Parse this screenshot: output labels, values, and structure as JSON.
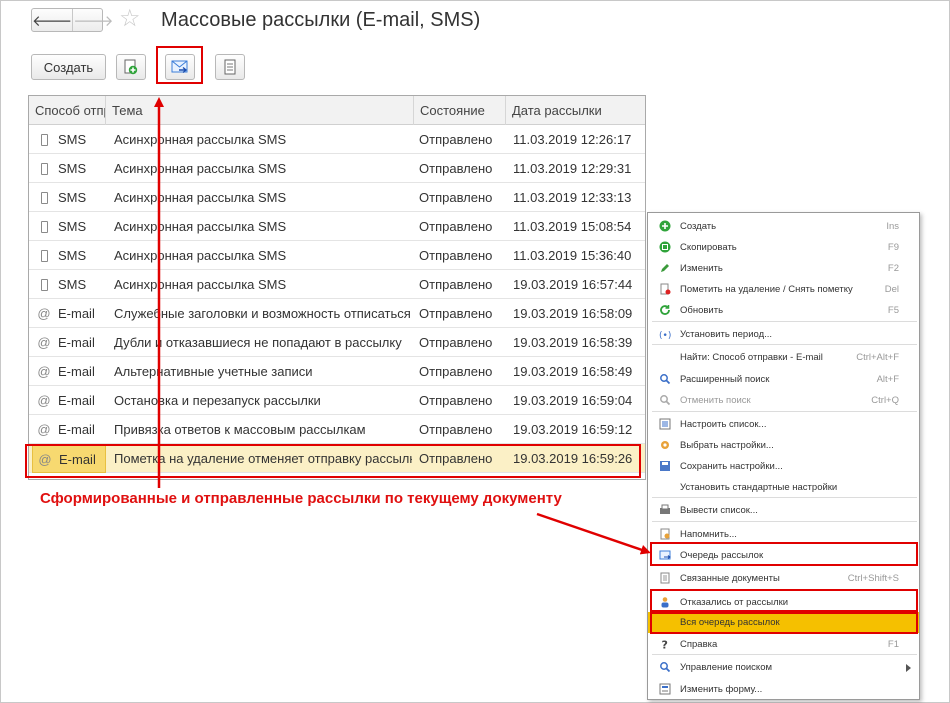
{
  "window": {
    "title": "Массовые рассылки (E-mail, SMS)"
  },
  "nav": {
    "back": "🡐",
    "forward": "🡒"
  },
  "toolbar": {
    "create_label": "Создать"
  },
  "table": {
    "columns": [
      "Способ отправки",
      "Тема",
      "Состояние",
      "Дата рассылки"
    ],
    "rows": [
      {
        "type": "phone",
        "method": "SMS",
        "subject": "Асинхронная рассылка SMS",
        "status": "Отправлено",
        "date": "11.03.2019 12:26:17"
      },
      {
        "type": "phone",
        "method": "SMS",
        "subject": "Асинхронная рассылка SMS",
        "status": "Отправлено",
        "date": "11.03.2019 12:29:31"
      },
      {
        "type": "phone",
        "method": "SMS",
        "subject": "Асинхронная рассылка SMS",
        "status": "Отправлено",
        "date": "11.03.2019 12:33:13"
      },
      {
        "type": "phone",
        "method": "SMS",
        "subject": "Асинхронная рассылка SMS",
        "status": "Отправлено",
        "date": "11.03.2019 15:08:54"
      },
      {
        "type": "phone",
        "method": "SMS",
        "subject": "Асинхронная рассылка SMS",
        "status": "Отправлено",
        "date": "11.03.2019 15:36:40"
      },
      {
        "type": "phone",
        "method": "SMS",
        "subject": "Асинхронная рассылка SMS",
        "status": "Отправлено",
        "date": "19.03.2019 16:57:44"
      },
      {
        "type": "at",
        "method": "E-mail",
        "subject": "Служебные заголовки и возможность отписаться",
        "status": "Отправлено",
        "date": "19.03.2019 16:58:09"
      },
      {
        "type": "at",
        "method": "E-mail",
        "subject": "Дубли и отказавшиеся не попадают в рассылку",
        "status": "Отправлено",
        "date": "19.03.2019 16:58:39"
      },
      {
        "type": "at",
        "method": "E-mail",
        "subject": "Альтернативные учетные записи",
        "status": "Отправлено",
        "date": "19.03.2019 16:58:49"
      },
      {
        "type": "at",
        "method": "E-mail",
        "subject": "Остановка и перезапуск рассылки",
        "status": "Отправлено",
        "date": "19.03.2019 16:59:04"
      },
      {
        "type": "at",
        "method": "E-mail",
        "subject": "Привязка ответов к массовым рассылкам",
        "status": "Отправлено",
        "date": "19.03.2019 16:59:12"
      },
      {
        "type": "at",
        "method": "E-mail",
        "subject": "Пометка на удаление отменяет отправку рассылки",
        "status": "Отправлено",
        "date": "19.03.2019 16:59:26",
        "selected": true
      }
    ]
  },
  "annotation": {
    "caption": "Сформированные и отправленные рассылки по текущему документу"
  },
  "menu": {
    "items": [
      {
        "label": "Создать",
        "shortcut": "Ins",
        "icon": "plus-icon"
      },
      {
        "label": "Скопировать",
        "shortcut": "F9",
        "icon": "copy-icon"
      },
      {
        "label": "Изменить",
        "shortcut": "F2",
        "icon": "pencil-icon"
      },
      {
        "label": "Пометить на удаление / Снять пометку",
        "shortcut": "Del",
        "icon": "delete-mark-icon"
      },
      {
        "label": "Обновить",
        "shortcut": "F5",
        "icon": "refresh-icon"
      },
      {
        "label": "Установить период...",
        "shortcut": "",
        "icon": "period-icon"
      },
      {
        "label": "Найти: Способ отправки - E-mail",
        "shortcut": "Ctrl+Alt+F",
        "icon": ""
      },
      {
        "label": "Расширенный поиск",
        "shortcut": "Alt+F",
        "icon": "search-icon"
      },
      {
        "label": "Отменить поиск",
        "shortcut": "Ctrl+Q",
        "icon": "cancel-search-icon",
        "disabled": true
      },
      {
        "label": "Настроить список...",
        "shortcut": "",
        "icon": "list-settings-icon"
      },
      {
        "label": "Выбрать настройки...",
        "shortcut": "",
        "icon": "choose-settings-icon"
      },
      {
        "label": "Сохранить настройки...",
        "shortcut": "",
        "icon": "save-settings-icon"
      },
      {
        "label": "Установить стандартные настройки",
        "shortcut": "",
        "icon": ""
      },
      {
        "label": "Вывести список...",
        "shortcut": "",
        "icon": "print-list-icon"
      },
      {
        "label": "Напомнить...",
        "shortcut": "",
        "icon": "reminder-icon"
      },
      {
        "label": "Очередь рассылок",
        "shortcut": "",
        "icon": "mail-queue-icon"
      },
      {
        "label": "Связанные документы",
        "shortcut": "Ctrl+Shift+S",
        "icon": "related-docs-icon"
      },
      {
        "label": "Отказались от рассылки",
        "shortcut": "",
        "icon": "unsubscribed-icon"
      },
      {
        "label": "Вся очередь рассылок",
        "shortcut": "",
        "icon": "",
        "active": true
      },
      {
        "label": "Справка",
        "shortcut": "F1",
        "icon": "help-icon"
      },
      {
        "label": "Управление поиском",
        "shortcut": "",
        "icon": "search-manage-icon",
        "submenu": true
      },
      {
        "label": "Изменить форму...",
        "shortcut": "",
        "icon": "form-edit-icon"
      }
    ]
  },
  "colors": {
    "highlight": "#e00000",
    "menu_active": "#f5c000",
    "selected_row": "#fbf0c6"
  }
}
